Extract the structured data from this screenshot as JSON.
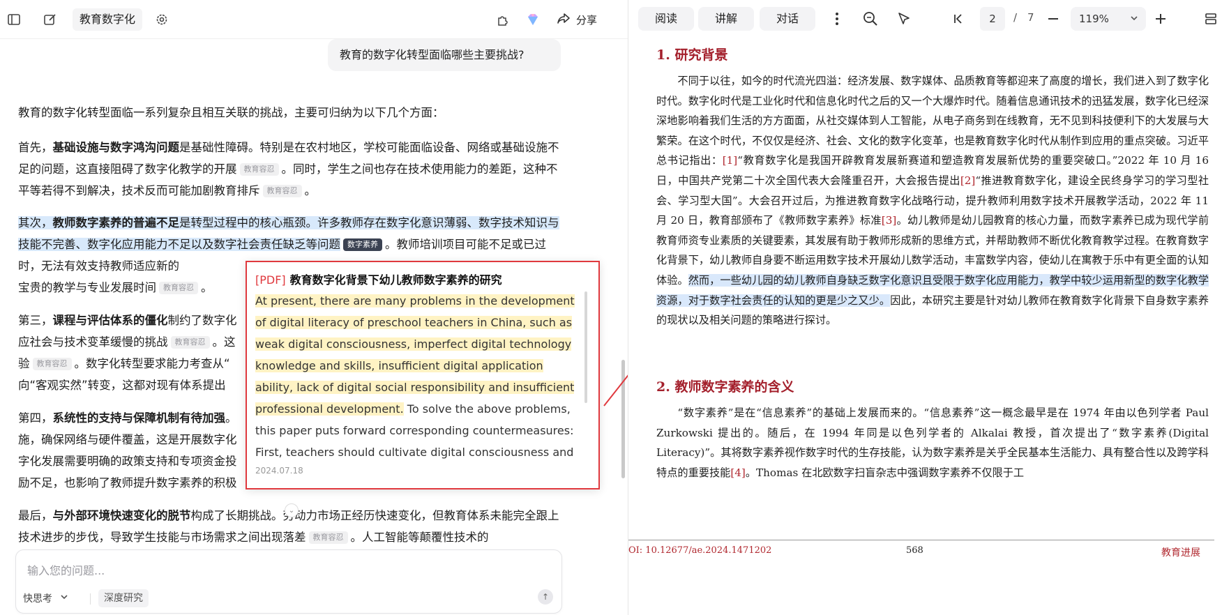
{
  "colors": {
    "accent_red": "#e0393e",
    "doc_heading": "#a4202c",
    "highlight_blue": "#d8e9fb",
    "highlight_yellow": "#fff3c4"
  },
  "left": {
    "chat_title": "教育数字化",
    "share_label": "分享",
    "icons": [
      "sidebar-toggle-icon",
      "new-chat-icon",
      "settings-icon",
      "plugin-icon",
      "gem-icon",
      "share-icon"
    ],
    "user_question": "教育的数字化转型面临哪些主要挑战?",
    "intro": "教育的数字化转型面临一系列复杂且相互关联的挑战，主要可归纳为以下几个方面：",
    "tag_edu": "教育容忍",
    "tag_digital": "数字素养",
    "p1": {
      "lead": "首先，",
      "bold": "基础设施与数字鸿沟问题",
      "t1": "是基础性障碍。特别是在农村地区，学校可能面临设备、网络或基础设施不足的问题，这直接阻碍了数字化教学的开展",
      "t2": "。同时，学生之间也存在技术使用能力的差距，这种不平等若得不到解决，技术反而可能加剧教育排斥",
      "t3": "。"
    },
    "p2": {
      "lead": "其次，",
      "bold": "教师数字素养的普遍不足",
      "t1": "是转型过程中的核心瓶颈。许多教师存在数字化意识薄弱、数字技术知识与技能不完善、数字化应用能力不足以及数字社会责任缺乏等问题",
      "t2": "。教师培训项目可能不足或已过时，无法有效支持教师适应新的",
      "t3": "宝贵的教学与专业发展时间",
      "t4": "。"
    },
    "p3": {
      "lead": "第三，",
      "bold": "课程与评估体系的僵化",
      "t1": "制约了数字化",
      "t2": "应社会与技术变革缓慢的挑战",
      "t3": "。这",
      "t4": "验",
      "t5": "。数字化转型要求能力考查从“",
      "t6": "向“客观实然”转变，这都对现有体系提出"
    },
    "p4": {
      "lead": "第四，",
      "bold": "系统性的支持与保障机制有待加强",
      "t1": "。",
      "t2": "施，确保网络与硬件覆盖，这是开展数字化",
      "t3": "字化发展需要明确的政策支持和专项资金投",
      "t4": "励不足，也影响了教师提升数字素养的积极"
    },
    "p5": {
      "lead": "最后，",
      "bold": "与外部环境快速变化的脱节",
      "t1": "构成了长期挑战。劳动力市场正经历快速变化，但教育体系未能完全跟上技术进步的步伐，导致学生技能与市场需求之间出现落差",
      "t2": "。人工智能等颠覆性技术的"
    },
    "input_placeholder": "输入您的问题...",
    "mode_label": "快思考",
    "deep_research_label": "深度研究"
  },
  "popup": {
    "source_tag": "[PDF]",
    "title": "教育数字化背景下幼儿教师数字素养的研究",
    "highlighted": "At present, there are many problems in the development of digital literacy of preschool teachers in China, such as weak digital consciousness, imperfect digital technology knowledge and skills, insufficient digital application ability, lack of digital social responsibility and insufficient professional development.",
    "rest": " To solve the above problems, this paper puts forward corresponding countermeasures: First, teachers should cultivate digital consciousness and",
    "date": "2024.07.18"
  },
  "right": {
    "tabs": [
      "阅读",
      "讲解",
      "对话"
    ],
    "current_page": "2",
    "page_sep": "/",
    "total_pages": "7",
    "zoom": "119%",
    "h1": "1.  研究背景",
    "para1_a": "不同于以往，如今的时代流光四溢：经济发展、数字媒体、品质教育等都迎来了高度的增长，我们进入到了数字化时代。数字化时代是工业化时代和信息化时代之后的又一个大爆炸时代。随着信息通讯技术的迅猛发展，数字化已经深深地影响着我们生活的方方面面，从社交媒体到人工智能，从电子商务到在线教育，无不见到科技便利下的大发展与大繁荣。在这个时代，不仅仅是经济、社会、文化的数字化变革，也是教育数字化时代从制作到应用的重点突破。习近平总书记指出：",
    "ref1": "[1]",
    "para1_b": "“教育数字化是我国开辟教育发展新赛道和塑造教育发展新优势的重要突破口。”2022 年 10 月 16 日，中国共产党第二十次全国代表大会隆重召开，大会报告提出",
    "ref2": "[2]",
    "para1_c": "“推进教育数字化，建设全民终身学习的学习型社会、学习型大国”。大会召开过后，为推进教育数字化战略行动，提升教师利用数字技术开展教学活动，2022 年 11 月 20 日，教育部颁布了《教师数字素养》标准",
    "ref3": "[3]",
    "para1_d": "。幼儿教师是幼儿园教育的核心力量，而数字素养已成为现代学前教育师资专业素质的关键要素，其发展有助于教师形成新的思维方式，并帮助教师不断优化教育教学过程。在教育数字化背景下，幼儿教师自身要不断运用数字技术开展幼儿数学活动，丰富数学内容，使幼儿在寓教于乐中有更全面的认知体验。",
    "para1_hl": "然而，一些幼儿园的幼儿教师自身缺乏数字化意识且受限于数字化应用能力，教学中较少运用新型的数字化教学资源，对于数字社会责任的认知的更是少之又少。",
    "para1_e": "因此，本研究主要是针对幼儿教师在教育数字化背景下自身数字素养的现状以及相关问题的策略进行探讨。",
    "h2": "2.  教师数字素养的含义",
    "para2_a": "“数字素养”是在“信息素养”的基础上发展而来的。“信息素养”这一概念最早是在 1974 年由以色列学者 Paul Zurkowski 提出的。随后，在 1994 年同是以色列学者的 Alkalai 教授，首次提出了“数字素养(Digital Literacy)”。其将数字素养视作数字时代的生存技能，认为数字素养是关乎全民基本生活能力、具有整合性以及跨学科特点的重要技能",
    "ref4": "[4]",
    "para2_b": "。Thomas 在北欧数字扫盲杂志中强调数字素养不仅限于工",
    "doi": "OI: 10.12677/ae.2024.1471202",
    "page_number": "568",
    "journal": "教育进展"
  }
}
